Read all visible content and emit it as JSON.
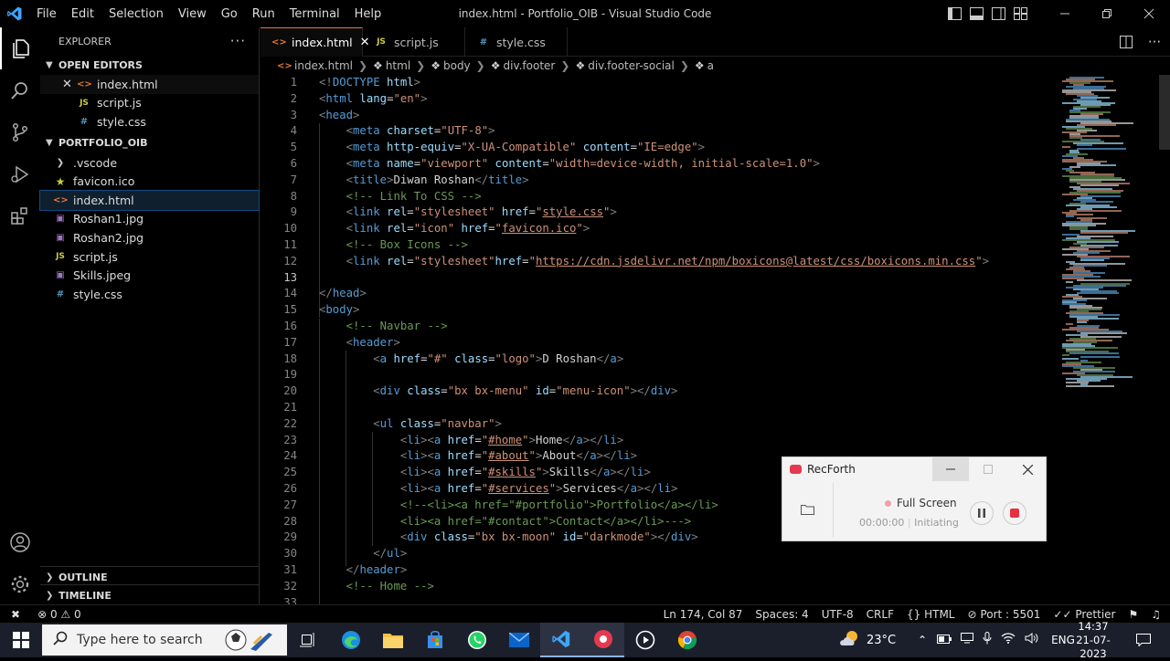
{
  "window": {
    "title": "index.html - Portfolio_OIB - Visual Studio Code",
    "menus": [
      "File",
      "Edit",
      "Selection",
      "View",
      "Go",
      "Run",
      "Terminal",
      "Help"
    ]
  },
  "sidebar": {
    "title": "EXPLORER",
    "open_editors_label": "OPEN EDITORS",
    "open_editors": [
      {
        "name": "index.html",
        "type": "html"
      },
      {
        "name": "script.js",
        "type": "js"
      },
      {
        "name": "style.css",
        "type": "css"
      }
    ],
    "project_label": "PORTFOLIO_OIB",
    "files": [
      {
        "name": ".vscode",
        "type": "folder"
      },
      {
        "name": "favicon.ico",
        "type": "ico"
      },
      {
        "name": "index.html",
        "type": "html"
      },
      {
        "name": "Roshan1.jpg",
        "type": "img"
      },
      {
        "name": "Roshan2.jpg",
        "type": "img"
      },
      {
        "name": "script.js",
        "type": "js"
      },
      {
        "name": "Skills.jpeg",
        "type": "img"
      },
      {
        "name": "style.css",
        "type": "css"
      }
    ],
    "outline_label": "OUTLINE",
    "timeline_label": "TIMELINE"
  },
  "tabs": [
    {
      "label": "index.html",
      "icon": "<>",
      "active": true
    },
    {
      "label": "script.js",
      "icon": "JS",
      "active": false
    },
    {
      "label": "style.css",
      "icon": "#",
      "active": false
    }
  ],
  "breadcrumb": [
    "index.html",
    "html",
    "body",
    "div.footer",
    "div.footer-social",
    "a"
  ],
  "editor": {
    "line_numbers": [
      "1",
      "2",
      "3",
      "4",
      "5",
      "6",
      "7",
      "8",
      "9",
      "10",
      "11",
      "12",
      "13",
      "14",
      "15",
      "16",
      "17",
      "18",
      "19",
      "20",
      "21",
      "22",
      "23",
      "24",
      "25",
      "26",
      "27",
      "28",
      "29",
      "30",
      "31",
      "32",
      "33"
    ],
    "code": {
      "l1_a": "<!",
      "l1_b": "DOCTYPE",
      "l1_c": " html",
      "l1_d": ">",
      "l2_tag": "html",
      "l2_attr": " lang",
      "l2_val": "\"en\"",
      "l3_tag": "head",
      "l4_tag": "meta",
      "l4_attr": " charset",
      "l4_val": "\"UTF-8\"",
      "l5_tag": "meta",
      "l5_attr1": " http-equiv",
      "l5_val1": "\"X-UA-Compatible\"",
      "l5_attr2": " content",
      "l5_val2": "\"IE=edge\"",
      "l6_tag": "meta",
      "l6_attr1": " name",
      "l6_val1": "\"viewport\"",
      "l6_attr2": " content",
      "l6_val2": "\"width=device-width, initial-scale=1.0\"",
      "l7_tag": "title",
      "l7_text": "Diwan Roshan",
      "l8": "<!-- Link To CSS -->",
      "l9_tag": "link",
      "l9_attr1": " rel",
      "l9_val1": "\"stylesheet\"",
      "l9_attr2": " href",
      "l9_val2": "style.css",
      "l10_tag": "link",
      "l10_attr1": " rel",
      "l10_val1": "\"icon\"",
      "l10_attr2": " href",
      "l10_val2": "favicon.ico",
      "l11": "<!-- Box Icons -->",
      "l12_tag": "link",
      "l12_attr1": " rel",
      "l12_val1": "\"stylesheet\"",
      "l12_attr2": "href",
      "l12_val2": "https://cdn.jsdelivr.net/npm/boxicons@latest/css/boxicons.min.css",
      "l14_tag": "head",
      "l15_tag": "body",
      "l16": "<!-- Navbar -->",
      "l17_tag": "header",
      "l18_tag": "a",
      "l18_attr1": " href",
      "l18_val1": "\"#\"",
      "l18_attr2": " class",
      "l18_val2": "\"logo\"",
      "l18_text": "D Roshan",
      "l20_tag": "div",
      "l20_attr1": " class",
      "l20_val1": "\"bx bx-menu\"",
      "l20_attr2": " id",
      "l20_val2": "\"menu-icon\"",
      "l22_tag": "ul",
      "l22_attr": " class",
      "l22_val": "\"navbar\"",
      "l23_href": "#home",
      "l23_text": "Home",
      "l24_href": "#about",
      "l24_text": "About",
      "l25_href": "#skills",
      "l25_text": "Skills",
      "l26_href": "#services",
      "l26_text": "Services",
      "l27": "<!--<li><a href=\"#portfolio\">Portfolio</a></li>",
      "l28": "<li><a href=\"#contact\">Contact</a></li>--->",
      "l29_tag": "div",
      "l29_attr1": " class",
      "l29_val1": "\"bx bx-moon\"",
      "l29_attr2": " id",
      "l29_val2": "\"darkmode\"",
      "l30_tag": "ul",
      "l31_tag": "header",
      "l32": "<!-- Home -->"
    }
  },
  "statusbar": {
    "errors": "0",
    "warnings": "0",
    "position": "Ln 174, Col 87",
    "spaces": "Spaces: 4",
    "encoding": "UTF-8",
    "eol": "CRLF",
    "language": "HTML",
    "port": "Port : 5501",
    "prettier": "Prettier"
  },
  "recforth": {
    "title": "RecForth",
    "mode": "Full Screen",
    "time": "00:00:00",
    "status": "Initiating"
  },
  "taskbar": {
    "search_placeholder": "Type here to search",
    "temperature": "23°C",
    "language": "ENG",
    "time": "14:37",
    "date": "21-07-2023"
  },
  "colors": {
    "accent": "#0078d4",
    "tag": "#569cd6",
    "attribute": "#9cdcfe",
    "string": "#ce9178",
    "comment": "#6a9955",
    "html_icon": "#e37933",
    "js_icon": "#cbcb41",
    "css_icon": "#519aba"
  }
}
